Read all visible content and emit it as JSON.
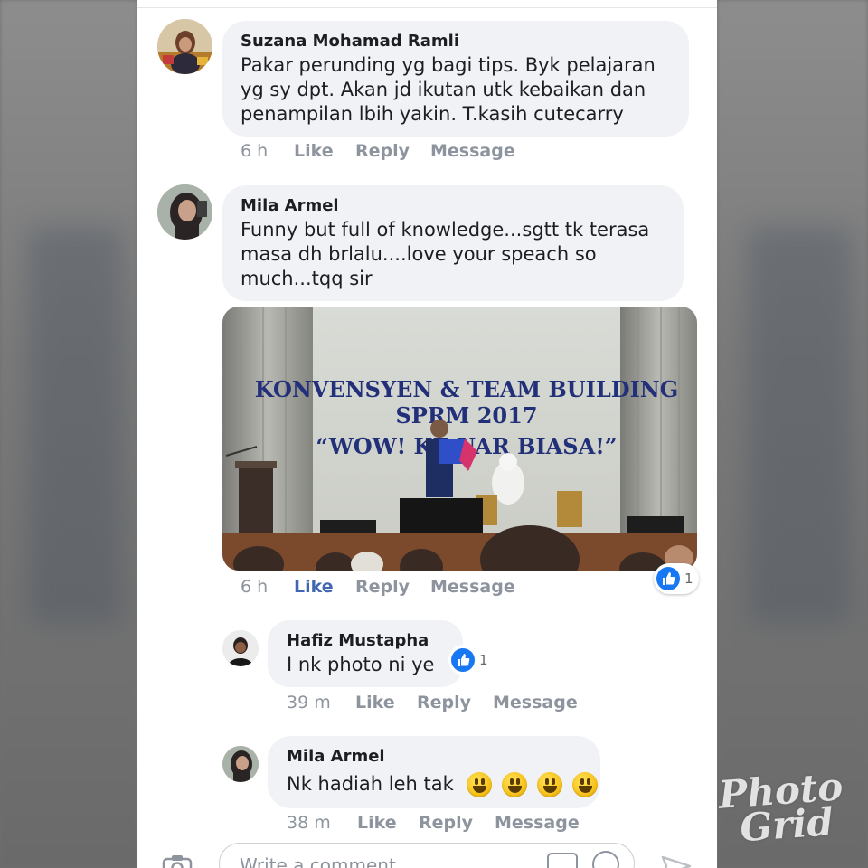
{
  "comments": [
    {
      "author": "Suzana Mohamad Ramli",
      "lines": [
        "Pakar perunding yg bagi tips. Byk pelajaran",
        "yg sy dpt. Akan jd ikutan utk kebaikan dan",
        "penampilan lbih yakin. T.kasih cutecarry"
      ],
      "time": "6 h",
      "like": "Like",
      "reply": "Reply",
      "message": "Message"
    },
    {
      "author": "Mila Armel",
      "lines": [
        "Funny but full of knowledge...sgtt tk terasa",
        "masa dh brlalu....love your speach so",
        "much...tqq sir"
      ],
      "photo": {
        "banner_line1": "KONVENSYEN & TEAM BUILDING",
        "banner_line2": "SPRM 2017",
        "banner_line3": "“WOW! KE   UAR BIASA!”"
      },
      "time": "6 h",
      "like": "Like",
      "reply": "Reply",
      "message": "Message",
      "reaction_count": "1"
    }
  ],
  "replies": [
    {
      "author": "Hafiz Mustapha",
      "text": "I nk photo ni ye",
      "reaction_count": "1",
      "time": "39 m",
      "like": "Like",
      "reply": "Reply",
      "message": "Message"
    },
    {
      "author": "Mila Armel",
      "text": "Nk hadiah leh tak",
      "time": "38 m",
      "like": "Like",
      "reply": "Reply",
      "message": "Message"
    }
  ],
  "composer": {
    "placeholder": "Write a comment..."
  },
  "watermark": {
    "line1": "Photo",
    "line2": "Grid"
  },
  "colors": {
    "like_active": "#4267b2",
    "like_badge": "#1877f2",
    "bubble": "#f1f2f5",
    "meta": "#8d949e"
  },
  "icons": [
    "like-icon",
    "camera-icon",
    "gif-icon",
    "emoji-icon",
    "send-icon"
  ]
}
